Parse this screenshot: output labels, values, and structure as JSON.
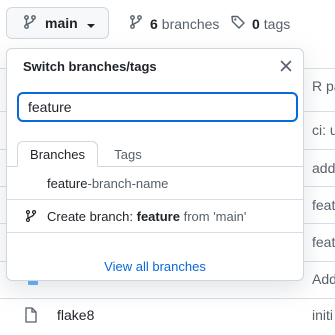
{
  "topbar": {
    "branch_label": "main",
    "branches_count": "6",
    "branches_label": "branches",
    "tags_count": "0",
    "tags_label": "tags"
  },
  "background": {
    "messages": [
      "R par",
      "ci: u",
      "add",
      "feat",
      "feat",
      "Add",
      "initi"
    ],
    "file_name": "flake8"
  },
  "dropdown": {
    "title": "Switch branches/tags",
    "search_value": "feature",
    "tabs": [
      {
        "label": "Branches",
        "active": true
      },
      {
        "label": "Tags",
        "active": false
      }
    ],
    "result": {
      "match": "feature",
      "rest": "-branch-name"
    },
    "create": {
      "prefix": "Create branch: ",
      "name": "feature",
      "from": " from 'main'"
    },
    "view_all": "View all branches"
  },
  "colors": {
    "accent": "#0969da",
    "border": "#d0d7de",
    "muted": "#57606a"
  },
  "icons": [
    "git-branch-icon",
    "chevron-down-icon",
    "tag-icon",
    "close-icon",
    "file-icon"
  ]
}
